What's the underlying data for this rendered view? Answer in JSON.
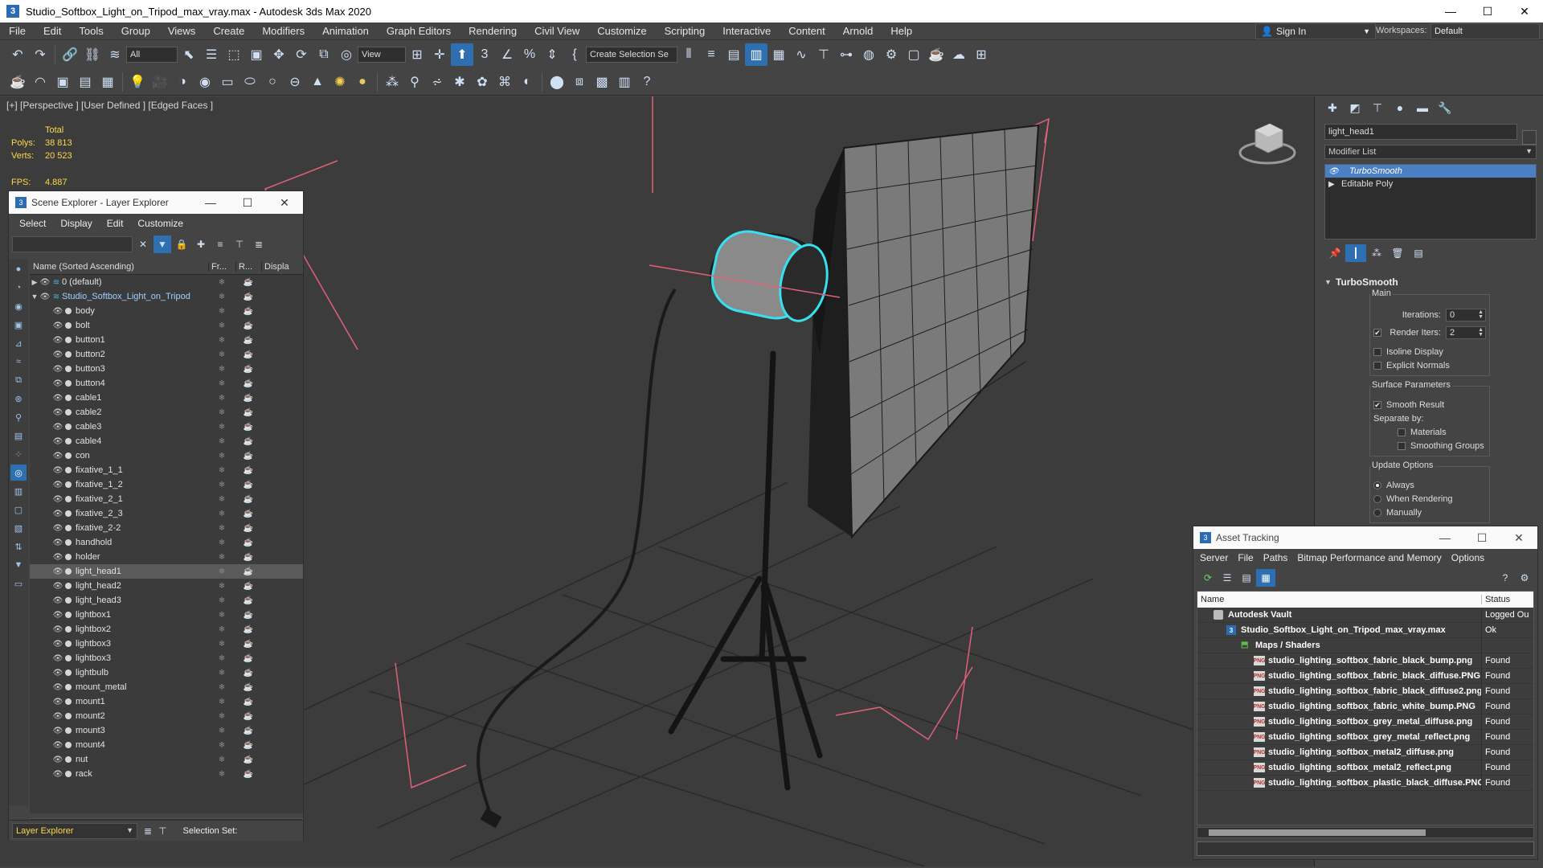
{
  "window": {
    "title": "Studio_Softbox_Light_on_Tripod_max_vray.max - Autodesk 3ds Max 2020",
    "minimize": "—",
    "maximize": "☐",
    "close": "✕"
  },
  "menu": [
    "File",
    "Edit",
    "Tools",
    "Group",
    "Views",
    "Create",
    "Modifiers",
    "Animation",
    "Graph Editors",
    "Rendering",
    "Civil View",
    "Customize",
    "Scripting",
    "Interactive",
    "Content",
    "Arnold",
    "Help"
  ],
  "signin": {
    "label": "Sign In"
  },
  "workspaces": {
    "label": "Workspaces:",
    "value": "Default"
  },
  "toolbar": {
    "selection_filter": "All",
    "ref_coord": "View",
    "named_selection": "Create Selection Se"
  },
  "viewport": {
    "label": "[+] [Perspective ] [User Defined ] [Edged Faces ]",
    "stats": {
      "total_label": "Total",
      "polys_label": "Polys:",
      "polys_value": "38 813",
      "verts_label": "Verts:",
      "verts_value": "20 523",
      "fps_label": "FPS:",
      "fps_value": "4.887"
    }
  },
  "scene_explorer": {
    "title": "Scene Explorer - Layer Explorer",
    "menu": [
      "Select",
      "Display",
      "Edit",
      "Customize"
    ],
    "columns": {
      "name": "Name (Sorted Ascending)",
      "frozen": "Fr...",
      "render": "R...",
      "display": "Displa"
    },
    "layers": [
      {
        "name": "0 (default)"
      },
      {
        "name": "Studio_Softbox_Light_on_Tripod"
      }
    ],
    "objects": [
      "body",
      "bolt",
      "button1",
      "button2",
      "button3",
      "button4",
      "cable1",
      "cable2",
      "cable3",
      "cable4",
      "con",
      "fixative_1_1",
      "fixative_1_2",
      "fixative_2_1",
      "fixative_2_3",
      "fixative_2-2",
      "handhold",
      "holder",
      "light_head1",
      "light_head2",
      "light_head3",
      "lightbox1",
      "lightbox2",
      "lightbox3",
      "lightbox3",
      "lightbulb",
      "mount_metal",
      "mount1",
      "mount2",
      "mount3",
      "mount4",
      "nut",
      "rack"
    ],
    "selected_object": "light_head1",
    "bottom": {
      "explorer": "Layer Explorer",
      "selection_set": "Selection Set:"
    }
  },
  "command_panel": {
    "object_name": "light_head1",
    "modifier_list": "Modifier List",
    "stack": [
      "TurboSmooth",
      "Editable Poly"
    ],
    "turbosmooth": {
      "title": "TurboSmooth",
      "main_label": "Main",
      "iterations_label": "Iterations:",
      "iterations_value": "0",
      "render_iters_label": "Render Iters:",
      "render_iters_value": "2",
      "render_iters_checked": true,
      "isoline_label": "Isoline Display",
      "explicit_normals_label": "Explicit Normals",
      "surface_params_label": "Surface Parameters",
      "smooth_result_label": "Smooth Result",
      "separate_by_label": "Separate by:",
      "materials_label": "Materials",
      "smoothing_groups_label": "Smoothing Groups",
      "update_options_label": "Update Options",
      "always_label": "Always",
      "when_rendering_label": "When Rendering",
      "manually_label": "Manually"
    }
  },
  "asset_tracking": {
    "title": "Asset Tracking",
    "menu": [
      "Server",
      "File",
      "Paths",
      "Bitmap Performance and Memory",
      "Options"
    ],
    "columns": {
      "name": "Name",
      "status": "Status"
    },
    "vault": {
      "name": "Autodesk Vault",
      "status": "Logged Ou"
    },
    "file": {
      "name": "Studio_Softbox_Light_on_Tripod_max_vray.max",
      "status": "Ok"
    },
    "folder": {
      "name": "Maps / Shaders"
    },
    "maps": [
      {
        "name": "studio_lighting_softbox_fabric_black_bump.png",
        "status": "Found"
      },
      {
        "name": "studio_lighting_softbox_fabric_black_diffuse.PNG",
        "status": "Found"
      },
      {
        "name": "studio_lighting_softbox_fabric_black_diffuse2.png",
        "status": "Found"
      },
      {
        "name": "studio_lighting_softbox_fabric_white_bump.PNG",
        "status": "Found"
      },
      {
        "name": "studio_lighting_softbox_grey_metal_diffuse.png",
        "status": "Found"
      },
      {
        "name": "studio_lighting_softbox_grey_metal_reflect.png",
        "status": "Found"
      },
      {
        "name": "studio_lighting_softbox_metal2_diffuse.png",
        "status": "Found"
      },
      {
        "name": "studio_lighting_softbox_metal2_reflect.png",
        "status": "Found"
      },
      {
        "name": "studio_lighting_softbox_plastic_black_diffuse.PNG",
        "status": "Found"
      }
    ],
    "png_badge": "PNG"
  },
  "colors": {
    "accent": "#2d6fb0",
    "stats_yellow": "#ffd84a",
    "selection_cyan": "#37e0f0",
    "gizmo_pink": "#e0607a"
  }
}
